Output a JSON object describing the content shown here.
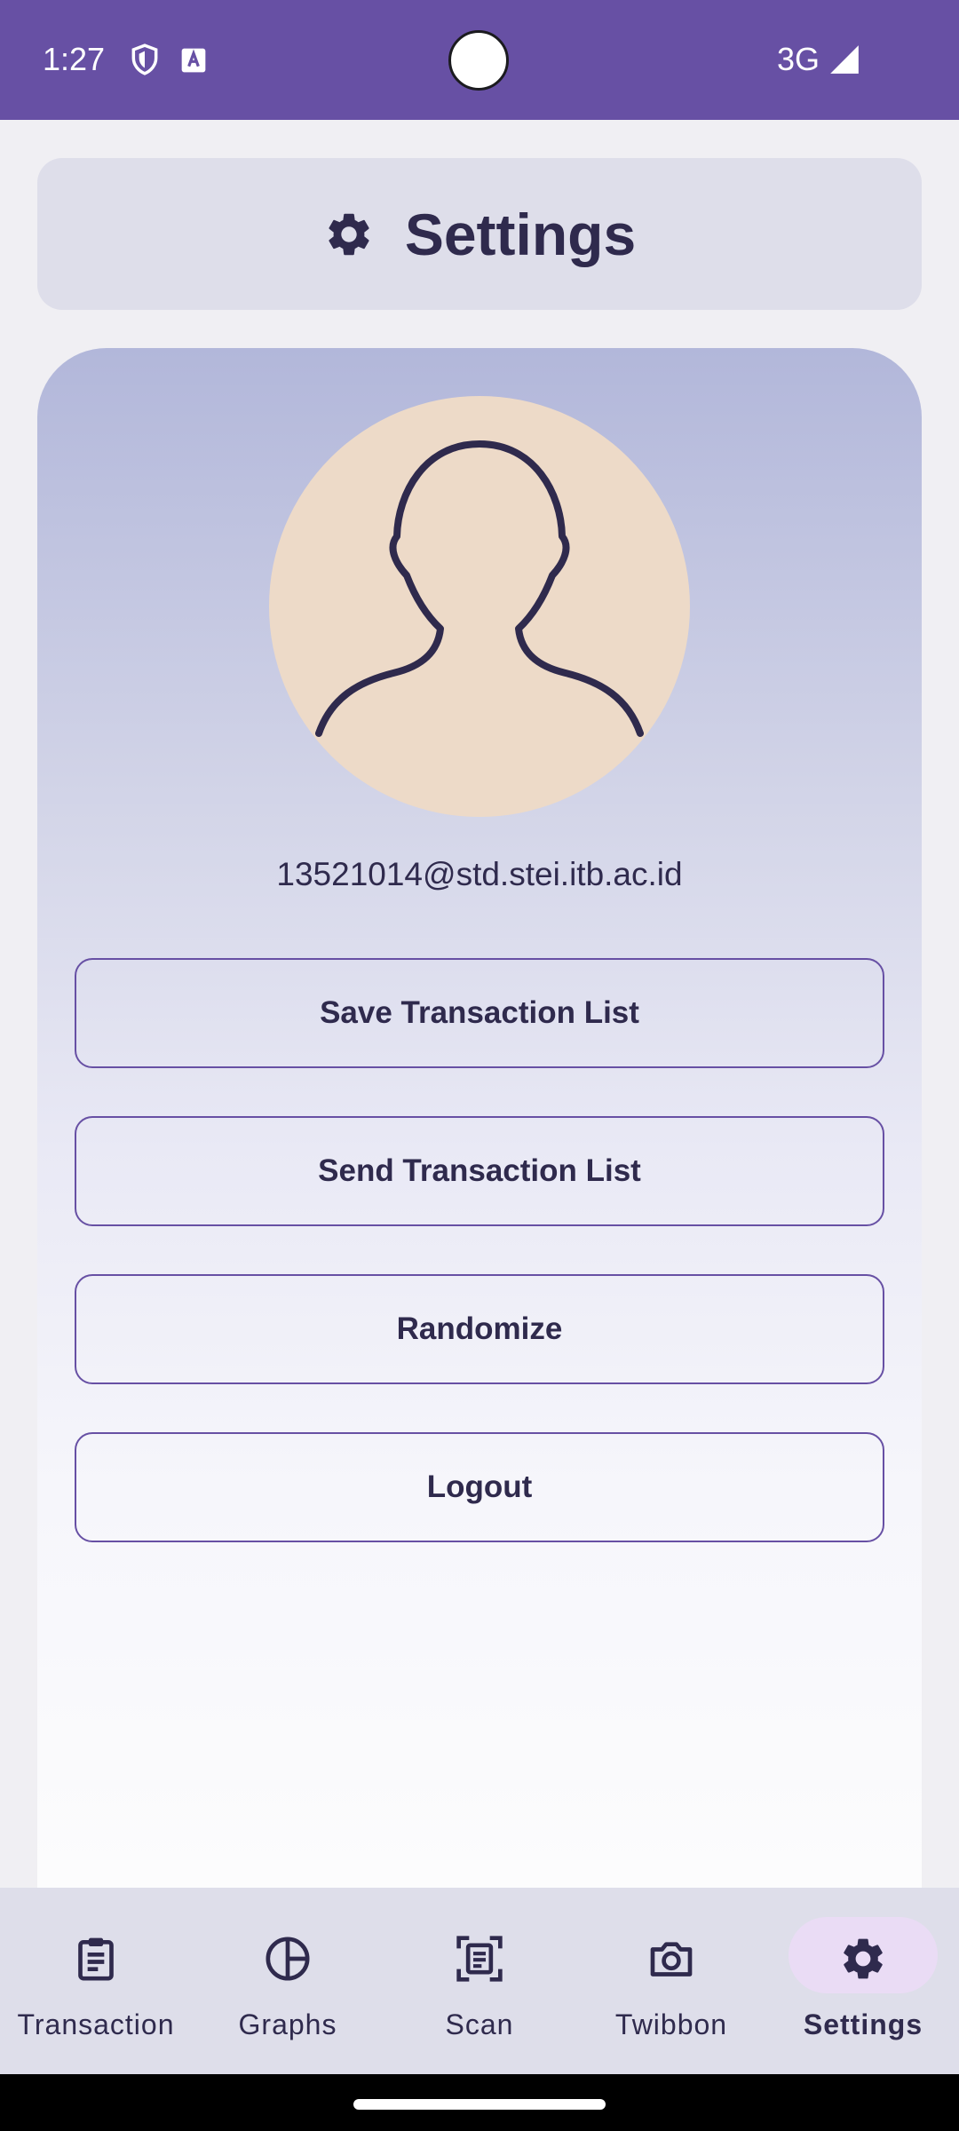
{
  "status_bar": {
    "time": "1:27",
    "network": "3G",
    "icons": [
      "shield-icon",
      "keyboard-a-icon",
      "signal-icon"
    ],
    "color": "#6750a4"
  },
  "header": {
    "title": "Settings",
    "icon": "gear-icon"
  },
  "profile": {
    "avatar_icon": "person-silhouette-icon",
    "email": "13521014@std.stei.itb.ac.id"
  },
  "actions": {
    "save_label": "Save Transaction List",
    "send_label": "Send Transaction List",
    "randomize_label": "Randomize",
    "logout_label": "Logout"
  },
  "bottom_nav": {
    "items": [
      {
        "label": "Transaction",
        "icon": "clipboard-icon",
        "active": false
      },
      {
        "label": "Graphs",
        "icon": "pie-chart-icon",
        "active": false
      },
      {
        "label": "Scan",
        "icon": "scan-document-icon",
        "active": false
      },
      {
        "label": "Twibbon",
        "icon": "camera-icon",
        "active": false
      },
      {
        "label": "Settings",
        "icon": "gear-icon",
        "active": true
      }
    ]
  },
  "colors": {
    "accent": "#6750a4",
    "text": "#2f2a4d",
    "active_pill": "#eadcf5"
  }
}
